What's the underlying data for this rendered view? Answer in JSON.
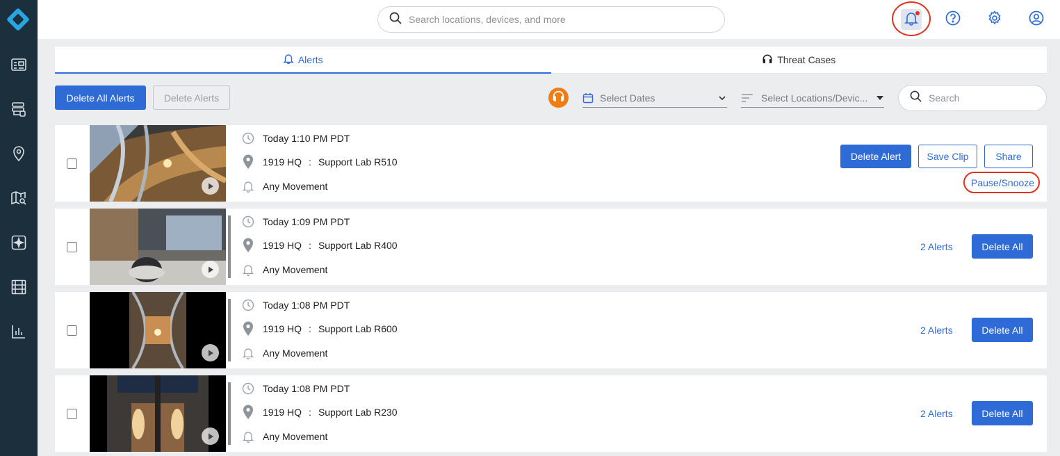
{
  "header": {
    "search_placeholder": "Search locations, devices, and more",
    "icons": [
      "bell-icon",
      "help-icon",
      "settings-icon",
      "account-icon"
    ]
  },
  "sidebar": {
    "items": [
      "dashboard-icon",
      "devices-icon",
      "location-icon",
      "map-icon",
      "add-widget-icon",
      "video-film-icon",
      "analytics-icon"
    ]
  },
  "tabs": [
    {
      "label": "Alerts",
      "active": true
    },
    {
      "label": "Threat Cases",
      "active": false
    }
  ],
  "toolbar": {
    "delete_all_alerts": "Delete All Alerts",
    "delete_alerts": "Delete Alerts",
    "select_dates": "Select Dates",
    "select_locations": "Select Locations/Devic...",
    "search_placeholder": "Search"
  },
  "alerts": [
    {
      "time": "Today 1:10 PM PDT",
      "site": "1919 HQ",
      "sep": ":",
      "device": "Support Lab R510",
      "event": "Any Movement",
      "actions": {
        "delete": "Delete Alert",
        "save": "Save Clip",
        "share": "Share",
        "pause": "Pause/Snooze"
      }
    },
    {
      "time": "Today 1:09 PM PDT",
      "site": "1919 HQ",
      "sep": ":",
      "device": "Support Lab R400",
      "event": "Any Movement",
      "count": "2 Alerts",
      "delete_all": "Delete All"
    },
    {
      "time": "Today 1:08 PM PDT",
      "site": "1919 HQ",
      "sep": ":",
      "device": "Support Lab R600",
      "event": "Any Movement",
      "count": "2 Alerts",
      "delete_all": "Delete All"
    },
    {
      "time": "Today 1:08 PM PDT",
      "site": "1919 HQ",
      "sep": ":",
      "device": "Support Lab R230",
      "event": "Any Movement",
      "count": "2 Alerts",
      "delete_all": "Delete All"
    }
  ],
  "colors": {
    "sidebar_bg": "#1c2f3d",
    "accent": "#2f6bd6",
    "highlight_ring": "#e0301e",
    "badge_orange": "#f07c14",
    "notification_dot": "#e0301e"
  }
}
